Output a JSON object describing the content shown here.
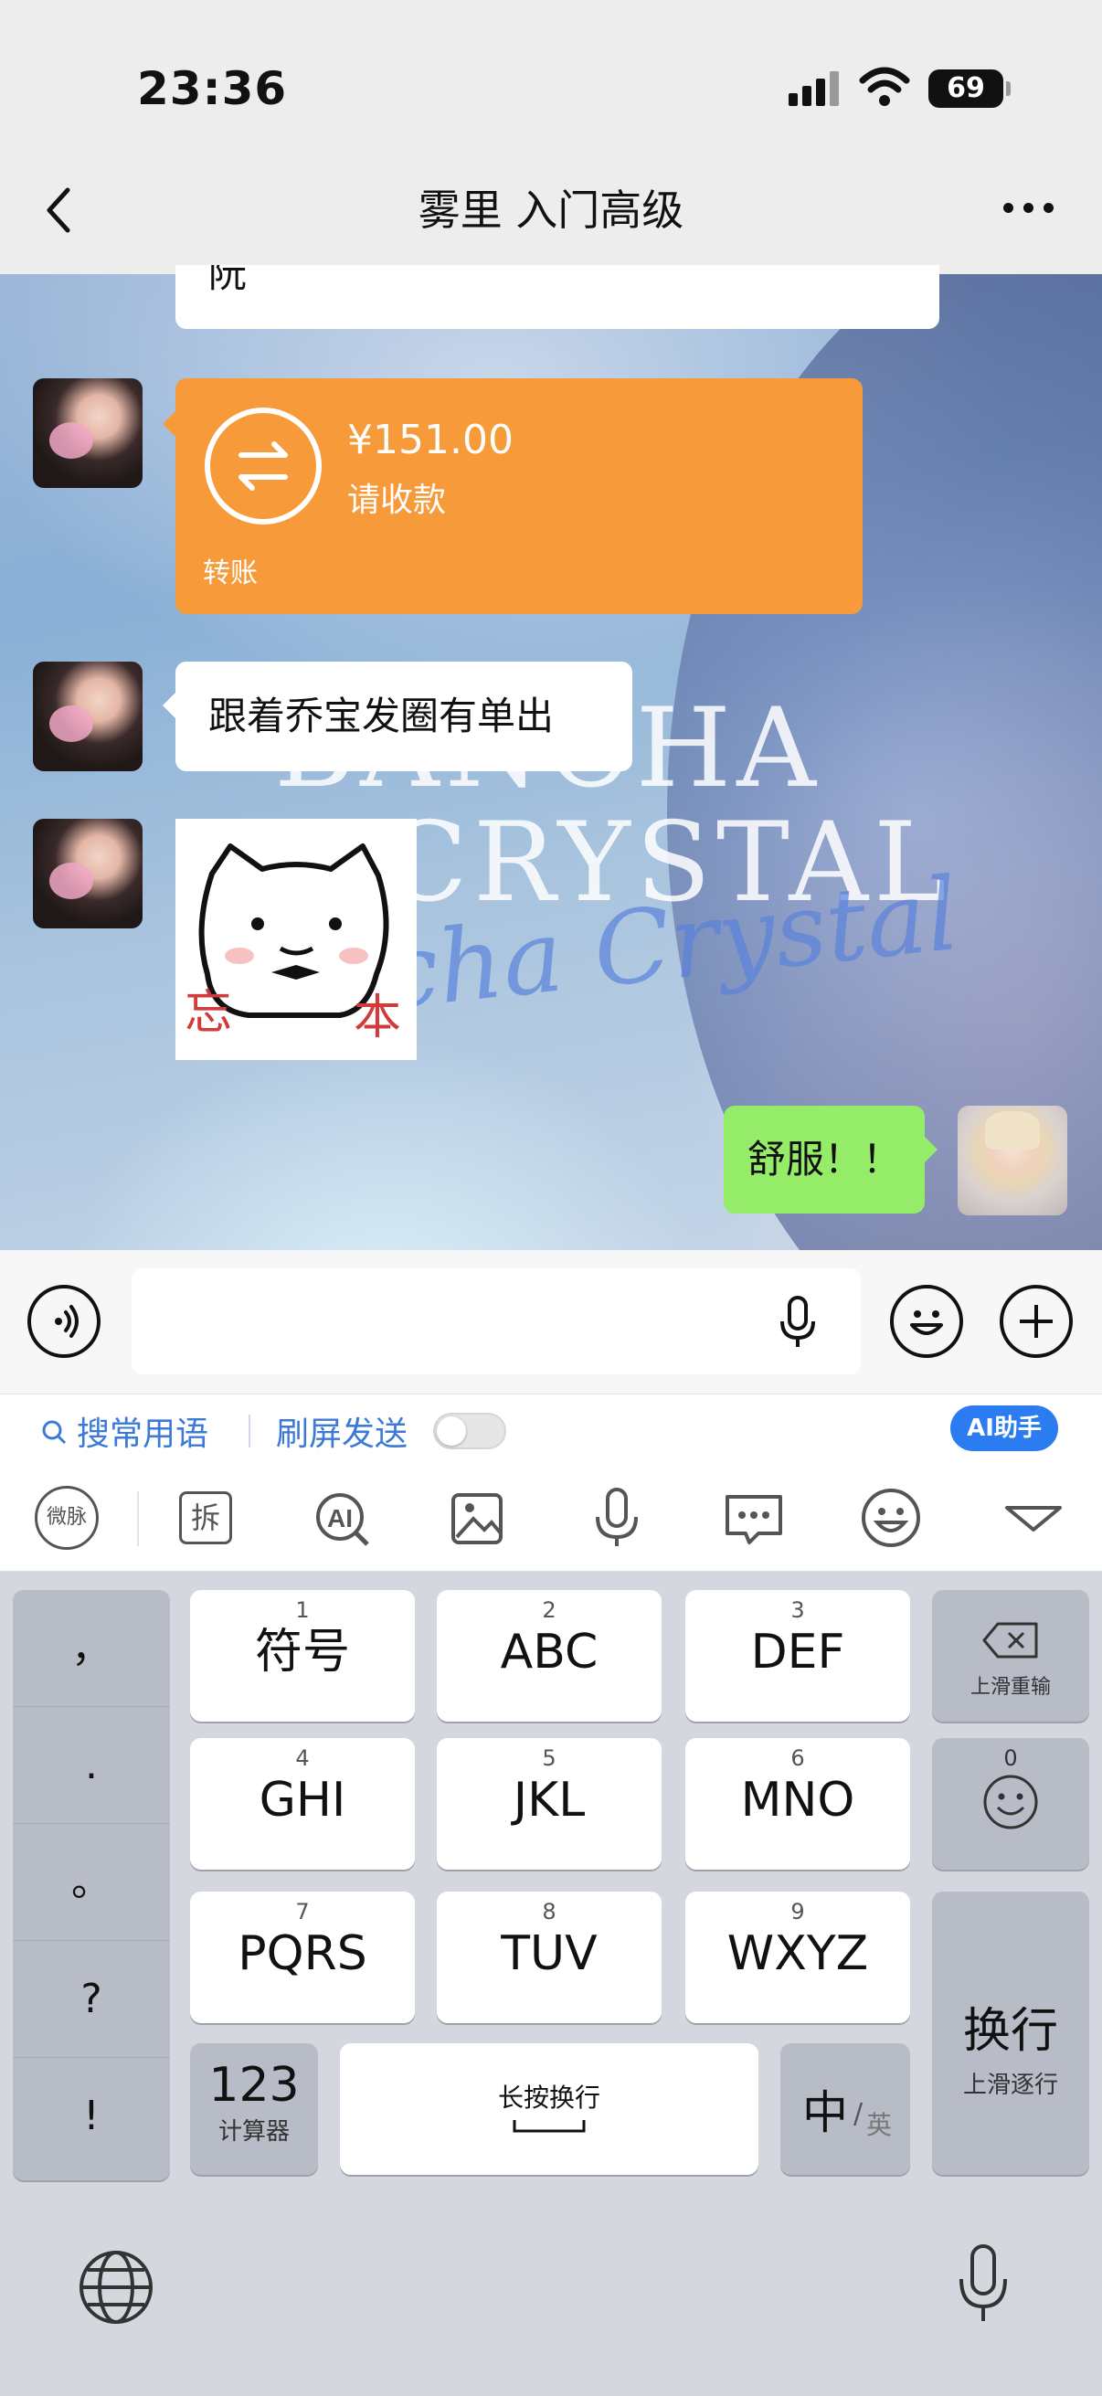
{
  "status_bar": {
    "time": "23:36",
    "battery": "69"
  },
  "header": {
    "title": "雾里 入门高级"
  },
  "messages": {
    "cut_text": "阮",
    "transfer": {
      "amount": "¥151.00",
      "status": "请收款",
      "label": "转账"
    },
    "text1": "跟着乔宝发圈有单出",
    "sticker": {
      "left_char": "忘",
      "right_char": "本"
    },
    "my_message": "舒服！！"
  },
  "wallpaper": {
    "line1": "BANCHA",
    "line2": "CRYSTAL",
    "script": "Bancha Crystal"
  },
  "ime": {
    "search_phrases": "搜常用语",
    "screen_send": "刷屏发送",
    "ai_button": "AI助手",
    "weibo_tool": "微脉",
    "split_tool": "拆"
  },
  "keyboard": {
    "punct": [
      "，",
      ".",
      "。",
      "?",
      "!"
    ],
    "keys": [
      {
        "num": "1",
        "label": "符号"
      },
      {
        "num": "2",
        "label": "ABC"
      },
      {
        "num": "3",
        "label": "DEF"
      },
      {
        "num": "4",
        "label": "GHI"
      },
      {
        "num": "5",
        "label": "JKL"
      },
      {
        "num": "6",
        "label": "MNO"
      },
      {
        "num": "7",
        "label": "PQRS"
      },
      {
        "num": "8",
        "label": "TUV"
      },
      {
        "num": "9",
        "label": "WXYZ"
      }
    ],
    "delete_sub": "上滑重输",
    "emoji_num": "0",
    "key123": "123",
    "key123_sub": "计算器",
    "space_label": "长按换行",
    "lang_main": "中",
    "lang_sub": "英",
    "enter": "换行",
    "enter_sub": "上滑逐行"
  },
  "colors": {
    "transfer": "#f79a3a",
    "my_bubble": "#95ec69",
    "link": "#3d7ad6",
    "ai": "#2a7cf0"
  }
}
